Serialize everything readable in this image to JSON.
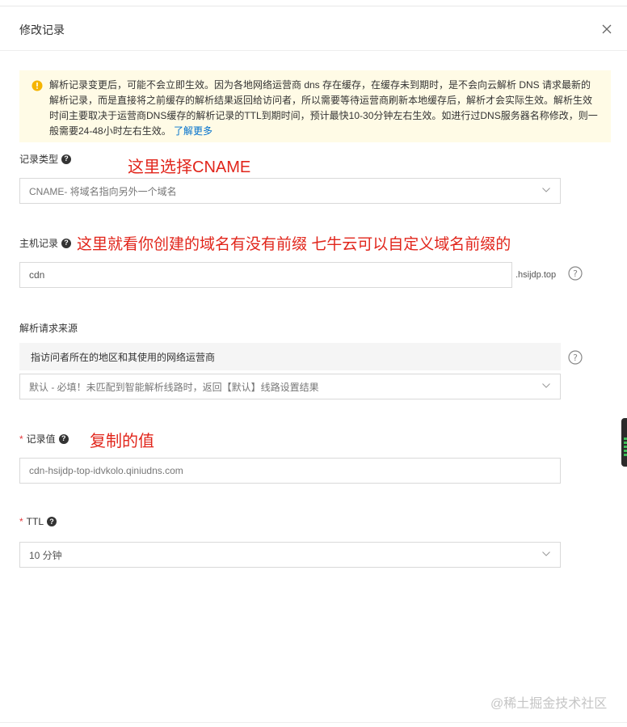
{
  "dialog": {
    "title": "修改记录"
  },
  "notice": {
    "text": "解析记录变更后，可能不会立即生效。因为各地网络运营商 dns 存在缓存，在缓存未到期时，是不会向云解析 DNS 请求最新的解析记录，而是直接将之前缓存的解析结果返回给访问者，所以需要等待运营商刷新本地缓存后，解析才会实际生效。解析生效时间主要取决于运营商DNS缓存的解析记录的TTL到期时间，预计最快10-30分钟左右生效。如进行过DNS服务器名称修改，则一般需要24-48小时左右生效。",
    "link": "了解更多"
  },
  "form": {
    "record_type": {
      "label": "记录类型",
      "value": "CNAME- 将域名指向另外一个域名",
      "annotation": "这里选择CNAME"
    },
    "host": {
      "label": "主机记录",
      "value": "cdn",
      "suffix": ".hsijdp.top",
      "annotation": "这里就看你创建的域名有没有前缀 七牛云可以自定义域名前缀的"
    },
    "source": {
      "label": "解析请求来源",
      "option_label": "指访问者所在的地区和其使用的网络运营商",
      "value": "默认 - 必填！未匹配到智能解析线路时，返回【默认】线路设置结果"
    },
    "record_value": {
      "label": "记录值",
      "value": "cdn-hsijdp-top-idvkolo.qiniudns.com",
      "annotation": "复制的值"
    },
    "ttl": {
      "label": "TTL",
      "value": "10 分钟"
    }
  },
  "watermark": "@稀土掘金技术社区",
  "colors": {
    "annotation": "#e1251b",
    "notice_bg": "#fffbe6",
    "link": "#0070cc",
    "warning_icon": "#f5b400"
  },
  "icons": [
    "close-icon",
    "warning-icon",
    "help-icon",
    "chevron-down-icon"
  ]
}
